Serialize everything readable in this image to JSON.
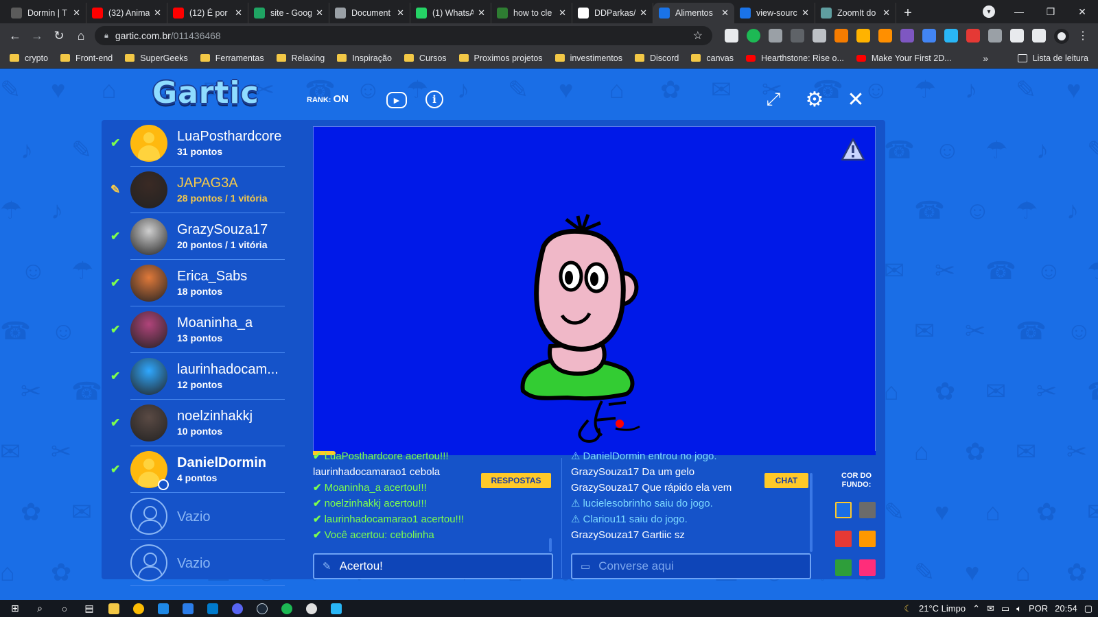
{
  "browser": {
    "tabs": [
      {
        "label": "Dormin | T",
        "icon": "tab-favicon",
        "color": "#5b5b5b"
      },
      {
        "label": "(32) Anima",
        "icon": "youtube-icon",
        "color": "#ff0000"
      },
      {
        "label": "(12) É por",
        "icon": "youtube-icon",
        "color": "#ff0000"
      },
      {
        "label": "site - Goog",
        "icon": "drive-icon",
        "color": "#1fa463"
      },
      {
        "label": "Document",
        "icon": "globe-icon",
        "color": "#9aa0a6"
      },
      {
        "label": "(1) WhatsA",
        "icon": "whatsapp-icon",
        "color": "#25d366"
      },
      {
        "label": "how to cle",
        "icon": "tab-favicon",
        "color": "#2e7d32"
      },
      {
        "label": "DDParkas/",
        "icon": "github-icon",
        "color": "#ffffff"
      },
      {
        "label": "Alimentos",
        "icon": "gartic-icon",
        "color": "#1a73e8",
        "active": true
      },
      {
        "label": "view-sourc",
        "icon": "gartic-icon",
        "color": "#1a73e8"
      },
      {
        "label": "ZoomIt do",
        "icon": "tab-favicon",
        "color": "#5f9ea0"
      }
    ],
    "new_tab": "+",
    "tab_close": "✕",
    "url_host": "gartic.com.br",
    "url_path": "/011436468",
    "bookmarks": [
      {
        "label": "crypto",
        "type": "folder"
      },
      {
        "label": "Front-end",
        "type": "folder"
      },
      {
        "label": "SuperGeeks",
        "type": "folder"
      },
      {
        "label": "Ferramentas",
        "type": "folder"
      },
      {
        "label": "Relaxing",
        "type": "folder"
      },
      {
        "label": "Inspiração",
        "type": "folder"
      },
      {
        "label": "Cursos",
        "type": "folder"
      },
      {
        "label": "Proximos projetos",
        "type": "folder"
      },
      {
        "label": "investimentos",
        "type": "folder"
      },
      {
        "label": "Discord",
        "type": "folder"
      },
      {
        "label": "canvas",
        "type": "folder"
      },
      {
        "label": "Hearthstone: Rise o...",
        "type": "youtube"
      },
      {
        "label": "Make Your First 2D...",
        "type": "youtube"
      }
    ],
    "bookmarks_more": "»",
    "reading_list": "Lista de leitura"
  },
  "game": {
    "logo": "Gartic",
    "rank_label": "RANK:",
    "rank_value": "ON",
    "players": [
      {
        "name": "LuaPosthardcore",
        "score": "31 pontos",
        "status": "correct",
        "avatar": "default"
      },
      {
        "name": "JAPAG3A",
        "score": "28 pontos / 1 vitória",
        "status": "drawing",
        "avatar": "photo",
        "avatar_color": "#3a2a24"
      },
      {
        "name": "GrazySouza17",
        "score": "20 pontos / 1 vitória",
        "status": "correct",
        "avatar": "photo",
        "avatar_color": "#cfcfcf"
      },
      {
        "name": "Erica_Sabs",
        "score": "18 pontos",
        "status": "correct",
        "avatar": "photo",
        "avatar_color": "#e0793a"
      },
      {
        "name": "Moaninha_a",
        "score": "13 pontos",
        "status": "correct",
        "avatar": "photo",
        "avatar_color": "#b0447a"
      },
      {
        "name": "laurinhadocam...",
        "score": "12 pontos",
        "status": "correct",
        "avatar": "photo",
        "avatar_color": "#2fa8ff"
      },
      {
        "name": "noelzinhakkj",
        "score": "10 pontos",
        "status": "correct",
        "avatar": "photo",
        "avatar_color": "#5a4a44"
      },
      {
        "name": "DanielDormin",
        "score": "4 pontos",
        "status": "correct",
        "avatar": "default",
        "me": true
      },
      {
        "name": "Vazio",
        "score": "",
        "status": "empty",
        "avatar": "empty"
      },
      {
        "name": "Vazio",
        "score": "",
        "status": "empty",
        "avatar": "empty"
      }
    ],
    "round_progress": 0.04,
    "answers": [
      {
        "text": "LuaPosthardcore acertou!!!",
        "kind": "ok"
      },
      {
        "text": "laurinhadocamarao1 cebola",
        "kind": "plain"
      },
      {
        "text": "Moaninha_a acertou!!!",
        "kind": "ok"
      },
      {
        "text": "noelzinhakkj acertou!!!",
        "kind": "ok"
      },
      {
        "text": "laurinhadocamarao1 acertou!!!",
        "kind": "ok"
      },
      {
        "text": "Você acertou: cebolinha",
        "kind": "ok"
      }
    ],
    "chat": [
      {
        "text": "DanielDormin entrou no jogo.",
        "kind": "sys"
      },
      {
        "text": "GrazySouza17 Da um gelo",
        "kind": "plain"
      },
      {
        "text": "GrazySouza17 Que rápido ela vem",
        "kind": "plain"
      },
      {
        "text": "lucielesobrinho saiu do jogo.",
        "kind": "sys"
      },
      {
        "text": "Clariou11 saiu do jogo.",
        "kind": "sys"
      },
      {
        "text": "GrazySouza17 Gartiic sz",
        "kind": "plain"
      }
    ],
    "answers_button": "RESPOSTAS",
    "chat_button": "CHAT",
    "answer_input": {
      "value": "Acertou!",
      "placeholder": ""
    },
    "chat_input": {
      "value": "",
      "placeholder": "Converse aqui"
    },
    "bg_color_label": "COR DO FUNDO:",
    "bg_colors": [
      "#1a6ee6",
      "#6b6b6b",
      "#e53935",
      "#ff9800",
      "#2e9e3a",
      "#ff2d7a"
    ],
    "bg_selected": 0,
    "colors": {
      "correct": "#7dff4d",
      "drawing": "#f5c94a",
      "system": "#7dd9ff",
      "canvas": "#0019e8",
      "accent": "#ffc928"
    }
  },
  "taskbar": {
    "weather": "21°C  Limpo",
    "lang": "POR",
    "time": "20:54"
  }
}
